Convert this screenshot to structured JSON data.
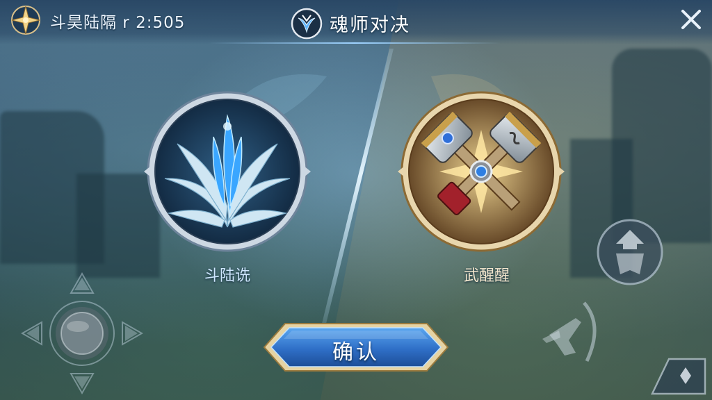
{
  "header": {
    "rank_text": "斗昊陆隔 r 2:505",
    "mode_title": "魂师对决",
    "rank_emblem_icon": "star-emblem-icon",
    "mode_icon": "wing-crest-icon",
    "close_icon": "close-icon"
  },
  "choices": {
    "left": {
      "label": "斗陆诜",
      "icon": "ice-blue-silver-grass-icon",
      "ring_color": "#9fb2c8"
    },
    "right": {
      "label": "武醒醒",
      "icon": "crossed-hammers-icon",
      "ring_color": "#d2a35a"
    }
  },
  "confirm": {
    "label": "确认"
  },
  "controls": {
    "joystick_icon": "virtual-joystick-icon",
    "skill_icon": "arrow-shield-skill-icon",
    "attack_icon": "horn-attack-icon",
    "corner_icon": "diamond-corner-icon"
  },
  "colors": {
    "accent_blue": "#2f6fc7",
    "gold_trim": "#e2c88b"
  }
}
